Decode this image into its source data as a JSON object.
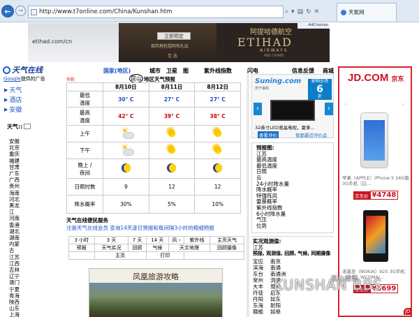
{
  "browser": {
    "url": "http://www.t7online.com/China/Kunshan.htm",
    "tab_title": "天氣网"
  },
  "banner_ad": {
    "ad_choices": "AdChoices",
    "etihad_url": "etihad.com/cn",
    "book_button": "立即预定",
    "dest_line": "目的地包括阿布扎比",
    "small_text": "佳 选",
    "brand_cn": "阿提哈德航空",
    "brand_en": "ETIHAD",
    "airways": "AIRWAYS",
    "abu_dhabi": "ABU DHABI"
  },
  "sidebar": {
    "logo_text": "天气在线",
    "google_label": "Google",
    "google_suffix": "提供的广告",
    "links": [
      "天气",
      "酒店",
      "安徽"
    ],
    "province_label": "天气::",
    "provinces": [
      "安徽",
      "北京",
      "重庆",
      "福建",
      "甘肃",
      "广东",
      "广西",
      "贵州",
      "海南",
      "河北",
      "黑龙江",
      "河南",
      "香港",
      "湖北",
      "湖南",
      "内蒙古",
      "江苏",
      "江西",
      "吉林",
      "辽宁",
      "澳门",
      "宁夏",
      "青海",
      "陕西",
      "山东",
      "上海",
      "山西"
    ]
  },
  "nav": {
    "items": [
      "国家(地区)",
      "城市",
      "卫星",
      "图",
      "紫外线指数",
      "闪电",
      "信息反馈",
      "商城"
    ]
  },
  "main": {
    "date_stamp": "华彩",
    "city": "昆山",
    "city_sub": "地区天气预报",
    "dates": [
      "8月10日",
      "8月11日",
      "8月12日"
    ],
    "rows": {
      "low_label": "最低\n温度",
      "low": [
        "30° C",
        "27° C",
        "27° C"
      ],
      "high_label": "最高\n温度",
      "high": [
        "42° C",
        "39° C",
        "38° C"
      ],
      "am_label": "上午",
      "pm_label": "下午",
      "night_label": "晚上 /\n夜间",
      "sun_label": "日照时数",
      "sun": [
        "9",
        "12",
        "12"
      ],
      "rain_label": "降水概率",
      "rain": [
        "30%",
        "5%",
        "10%"
      ]
    },
    "services_title": "天气在线便民服务",
    "services_line": "注册天气在线会员 查询14天逐日预报和每间隔3小时的精细预报",
    "svc_row1": [
      "3 小时",
      "3  天",
      "7 天",
      "14 天",
      "风 ›",
      "紫外线",
      "主页天气"
    ],
    "svc_row2": [
      "预报",
      "天气实况",
      "回顾",
      "气候",
      "天文地理",
      "回顾摄像"
    ],
    "svc_row3": [
      "主页",
      "打印"
    ],
    "travel_title": "凤凰旅游攻略"
  },
  "suning_ad": {
    "logo": "Suning.com",
    "slogan": "苏宁易购",
    "badge_top": "影响全场",
    "badge_num": "6",
    "badge_bottom": "折",
    "desc": "32英寸LED液晶电视，夏季...",
    "link1": "查看评价",
    "link2": "我都最近评价品"
  },
  "forecast_box": {
    "title": "预报图:",
    "items": [
      "江苏",
      "最高温度",
      "最低温度",
      "日照",
      "云",
      "24小时降水量",
      "降水概率",
      "特强阵风",
      "雷暴概率",
      "紫外线指数",
      "6小时降水量",
      "气压",
      "位势"
    ]
  },
  "obs_box": {
    "title": "实况观测值:",
    "region": "江苏",
    "sub": "预报, 观测值, 回顾, 气候, 同期摄像",
    "col1": [
      "宝应",
      "滨海",
      "东台",
      "常州",
      "大丰",
      "丹徒",
      "丹阳",
      "东海",
      "赣榆"
    ],
    "col2": [
      "南京",
      "南通",
      "南通洲",
      "洪泽",
      "邳州",
      "启东",
      "如东",
      "射阳",
      "如皋"
    ]
  },
  "jd_ad": {
    "logo_cn": "京东",
    "logo_en": "JD.COM",
    "phone1_caption": "苹果（APPLE）iPhone 5 16G版 3G手机（白...",
    "phone1_tag": "京东价",
    "phone1_price": "¥4748",
    "phone2_caption": "诺基亚（NOKIA）925 3G手机（白色）WCDMA/...",
    "phone2_tag": "京东价",
    "phone2_price": "¥3699",
    "corner": "JD"
  },
  "watermark": {
    "text": "KUNSHAN BBS",
    "small": "昆山论坛"
  }
}
